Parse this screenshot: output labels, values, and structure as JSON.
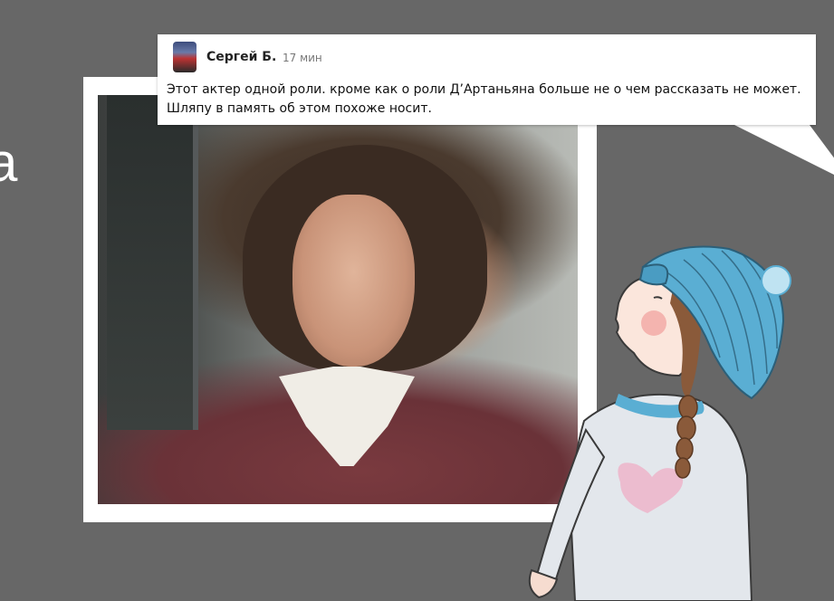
{
  "edge_char": "а",
  "comment": {
    "author": "Сергей Б.",
    "time": "17 мин",
    "text": "Этот актер одной роли. кроме как о роли Д’Артаньяна больше не о чем рассказать не может. Шляпу в память об этом похоже носит.",
    "avatar_icon": "user-avatar"
  },
  "colors": {
    "background": "#676767",
    "card": "#ffffff",
    "hat": "#5aaed3",
    "sweater": "#e3e7ec",
    "heart": "#ecbccf",
    "hair": "#8a5a3a"
  }
}
